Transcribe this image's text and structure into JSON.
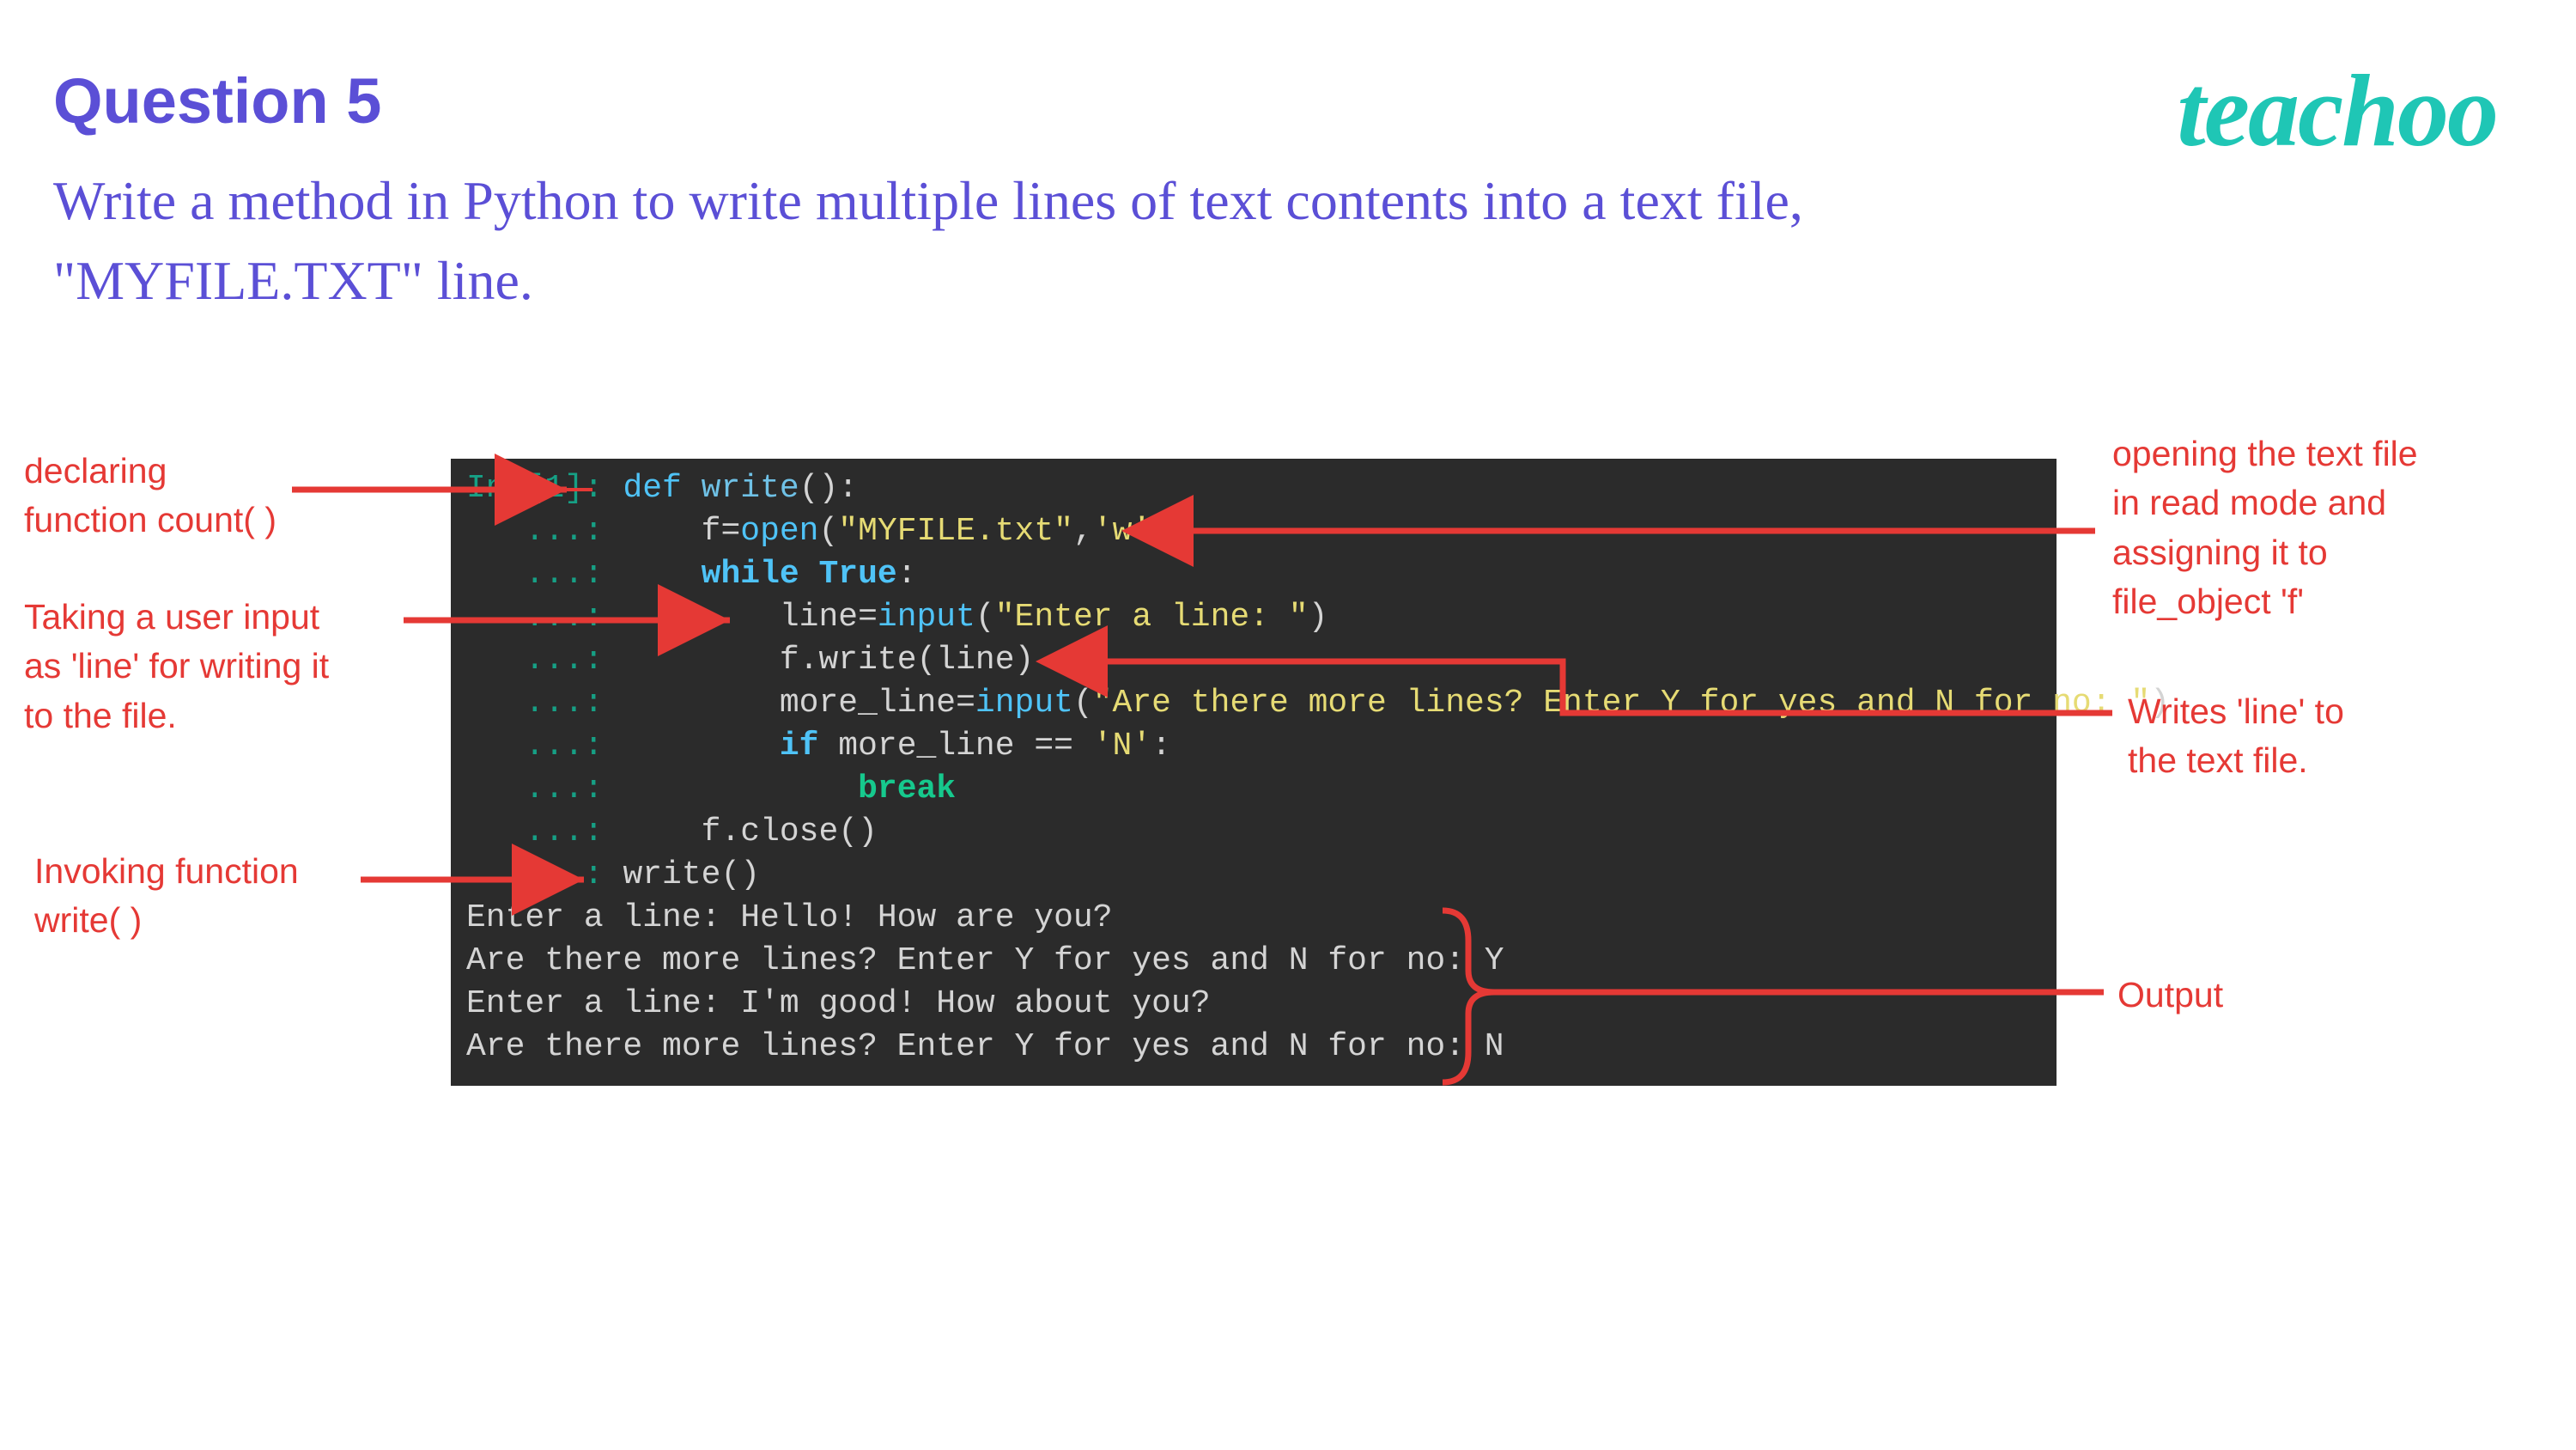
{
  "header": {
    "title": "Question 5",
    "question": "Write a method in Python to write multiple lines  of text contents into a text file, \"MYFILE.TXT\" line.",
    "logo": "teachoo"
  },
  "code": {
    "line1_prompt": "In [1]: ",
    "line1_def": "def ",
    "line1_fn": "write",
    "line1_rest": "():",
    "dots": "   ...: ",
    "l2_a": "    f=",
    "l2_b": "open",
    "l2_c": "(",
    "l2_d": "\"MYFILE.txt\"",
    "l2_e": ",",
    "l2_f": "'w'",
    "l2_g": ")",
    "l3_a": "    ",
    "l3_b": "while ",
    "l3_c": "True",
    "l3_d": ":",
    "l4_a": "        line=",
    "l4_b": "input",
    "l4_c": "(",
    "l4_d": "\"Enter a line: \"",
    "l4_e": ")",
    "l5_a": "        f.write(line)",
    "l6_a": "        more_line=",
    "l6_b": "input",
    "l6_c": "(",
    "l6_d": "\"Are there more lines? Enter Y for yes and N for no: \"",
    "l6_e": ")",
    "l7_a": "        ",
    "l7_b": "if ",
    "l7_c": "more_line == ",
    "l7_d": "'N'",
    "l7_e": ":",
    "l8_a": "            ",
    "l8_b": "break",
    "l9_a": "    f.close()",
    "l10_a": "write()",
    "out1": "Enter a line: Hello! How are you?",
    "out2": "Are there more lines? Enter Y for yes and N for no: Y",
    "out3": "Enter a line: I'm good! How about you?",
    "out4": "Are there more lines? Enter Y for yes and N for no: N"
  },
  "annotations": {
    "left1": "declaring\nfunction count( )",
    "left2": "Taking a user input\nas 'line' for writing it\nto the file.",
    "left3": "Invoking function\nwrite( )",
    "right1": "opening the text file\nin read mode and\nassigning it to\nfile_object 'f'",
    "right2": "Writes 'line' to\nthe text file.",
    "right3": "Output"
  }
}
